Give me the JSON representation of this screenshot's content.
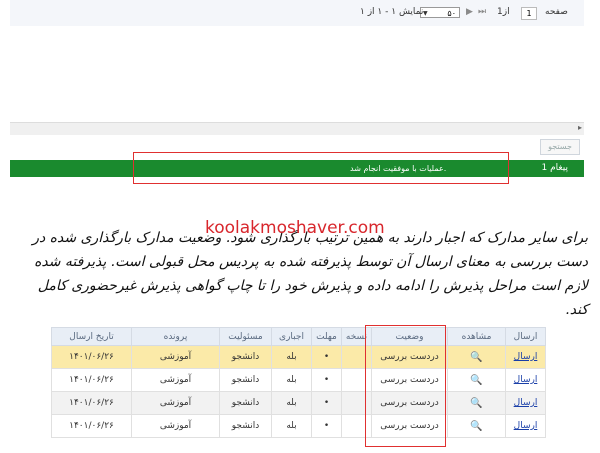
{
  "pager": {
    "page_label": "صفحه",
    "page_value": "1",
    "of_label": "از1",
    "page_size": "۵۰",
    "showing": "نمایش ۱ - ۱ از ۱",
    "nav_first": "⏮",
    "nav_prev": "◀",
    "nav_next": "▶",
    "nav_last": "⏭"
  },
  "search_button": "جستجو",
  "message_bar": {
    "count": "1 پیغام",
    "text": "عملیات با موفقیت انجام شد."
  },
  "watermark": "koolakmoshaver.com",
  "paragraph": "برای سایر مدارک که اجبار دارند به همین ترتیب بارگذاری شود. وضعیت مدارک بارگذاری شده در دست بررسی به معنای ارسال آن توسط پذیرفته شده به پردیس محل قبولی است. پذیرفته شده لازم است مراحل پذیرش را ادامه داده و پذیرش خود را تا چاپ گواهی پذیرش غیرحضوری کامل کند.",
  "table": {
    "headers": [
      "ارسال",
      "مشاهده",
      "وضعیت",
      "نسخه",
      "مهلت",
      "اجباری",
      "مسئولیت",
      "پرونده",
      "تاریخ ارسال"
    ],
    "rows": [
      {
        "send": "ارسال",
        "view": "🔍",
        "status": "دردست بررسی",
        "version": "",
        "deadline": "•",
        "mandatory": "بله",
        "responsibility": "دانشجو",
        "file": "آموزشی",
        "date": "۱۴۰۱/۰۶/۲۶"
      },
      {
        "send": "ارسال",
        "view": "🔍",
        "status": "دردست بررسی",
        "version": "",
        "deadline": "•",
        "mandatory": "بله",
        "responsibility": "دانشجو",
        "file": "آموزشی",
        "date": "۱۴۰۱/۰۶/۲۶"
      },
      {
        "send": "ارسال",
        "view": "🔍",
        "status": "دردست بررسی",
        "version": "",
        "deadline": "•",
        "mandatory": "بله",
        "responsibility": "دانشجو",
        "file": "آموزشی",
        "date": "۱۴۰۱/۰۶/۲۶"
      },
      {
        "send": "ارسال",
        "view": "🔍",
        "status": "دردست بررسی",
        "version": "",
        "deadline": "•",
        "mandatory": "بله",
        "responsibility": "دانشجو",
        "file": "آموزشی",
        "date": "۱۴۰۱/۰۶/۲۶"
      }
    ]
  },
  "colors": {
    "message_bar": "#1a8a2e",
    "highlight_row": "#fbeaa8",
    "annotation_frame": "#e03030",
    "watermark": "#d8262c"
  }
}
